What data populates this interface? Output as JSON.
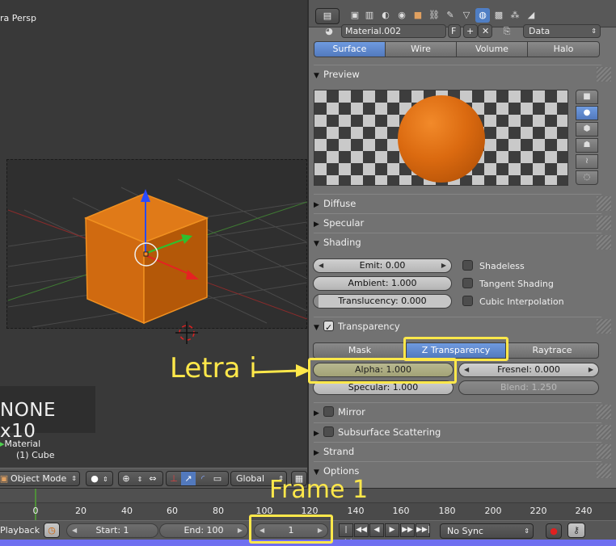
{
  "viewport": {
    "view_label": "ra Persp",
    "fps_text": "NONE x10",
    "material_label": "Material",
    "object_label": "(1) Cube",
    "header": {
      "mode": "Object Mode",
      "orientation": "Global"
    }
  },
  "properties": {
    "material_name": "Material.002",
    "fake_user": "F",
    "link": "Data",
    "type_tabs": [
      {
        "label": "Surface",
        "active": true
      },
      {
        "label": "Wire",
        "active": false
      },
      {
        "label": "Volume",
        "active": false
      },
      {
        "label": "Halo",
        "active": false
      }
    ],
    "panels": {
      "preview": "Preview",
      "diffuse": "Diffuse",
      "specular": "Specular",
      "shading": "Shading",
      "transparency": "Transparency",
      "mirror": "Mirror",
      "sss": "Subsurface Scattering",
      "strand": "Strand",
      "options": "Options"
    },
    "shading": {
      "emit": "Emit: 0.00",
      "ambient": "Ambient: 1.000",
      "translucency": "Translucency: 0.000",
      "shadeless": "Shadeless",
      "tangent": "Tangent Shading",
      "cubic": "Cubic Interpolation"
    },
    "transparency": {
      "methods": [
        {
          "label": "Mask",
          "active": false
        },
        {
          "label": "Z Transparency",
          "active": true
        },
        {
          "label": "Raytrace",
          "active": false
        }
      ],
      "alpha": "Alpha: 1.000",
      "fresnel": "Fresnel: 0.000",
      "specular": "Specular: 1.000",
      "blend": "Blend: 1.250"
    },
    "colors": {
      "accent": "#5279bd",
      "material": "#db6a10"
    }
  },
  "timeline": {
    "ticks": [
      "0",
      "20",
      "40",
      "60",
      "80",
      "100",
      "120",
      "140",
      "160",
      "180",
      "200",
      "220",
      "240"
    ],
    "playback_label": "Playback",
    "start": "Start: 1",
    "end": "End: 100",
    "current_frame": "1",
    "sync": "No Sync"
  },
  "annotations": {
    "letra": "Letra i",
    "frame": "Frame 1",
    "color": "#ffe84a"
  }
}
